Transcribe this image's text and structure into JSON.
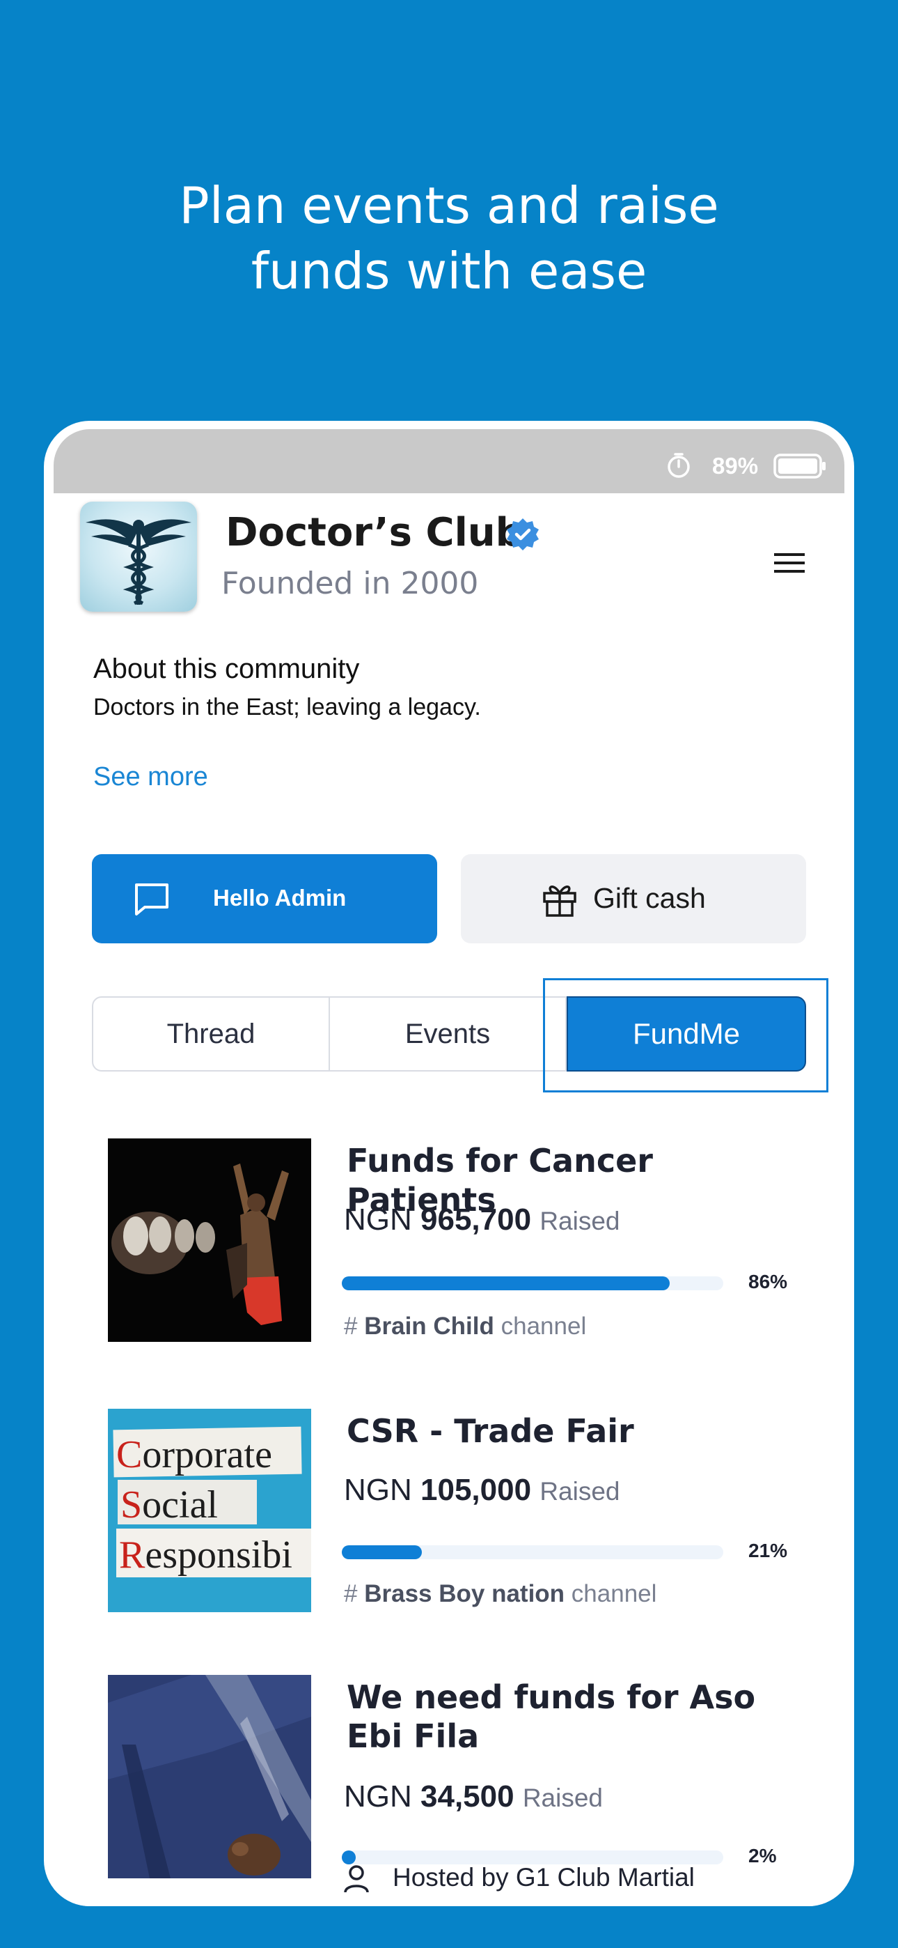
{
  "headline": {
    "line1": "Plan events and raise",
    "line2": "funds with ease"
  },
  "status_bar": {
    "battery_percent": "89%",
    "icons": [
      "timer-icon",
      "battery-icon"
    ]
  },
  "community": {
    "name": "Doctor’s Club",
    "founded": "Founded in 2000",
    "verified": true,
    "about_title": "About this community",
    "about_text": "Doctors in the East; leaving a legacy.",
    "see_more": "See more"
  },
  "actions": {
    "admin_label": "Hello Admin",
    "gift_label": "Gift cash"
  },
  "tabs": [
    {
      "label": "Thread",
      "active": false
    },
    {
      "label": "Events",
      "active": false
    },
    {
      "label": "FundMe",
      "active": true
    }
  ],
  "funds": [
    {
      "title": "Funds for Cancer Patients",
      "currency": "NGN",
      "amount": "965,700",
      "raised_label": "Raised",
      "progress": 0.86,
      "progress_label": "86%",
      "channel_prefix": "#",
      "channel_name": "Brain Child",
      "channel_suffix": "channel"
    },
    {
      "title": "CSR - Trade Fair",
      "currency": "NGN",
      "amount": "105,000",
      "raised_label": "Raised",
      "progress": 0.21,
      "progress_label": "21%",
      "channel_prefix": "#",
      "channel_name": "Brass Boy nation",
      "channel_suffix": "channel",
      "thumb_text": {
        "line1_cap": "C",
        "line1": "orporate",
        "line2_cap": "S",
        "line2": "ocial",
        "line3_cap": "R",
        "line3": "esponsibi"
      }
    },
    {
      "title": "We need funds for Aso Ebi Fila",
      "currency": "NGN",
      "amount": "34,500",
      "raised_label": "Raised",
      "progress": 0.02,
      "progress_label": "2%",
      "host_label": "Hosted by G1 Club Martial"
    }
  ],
  "colors": {
    "background": "#0683c8",
    "accent": "#0f7fd6",
    "status_bar": "#c9c9c9"
  }
}
